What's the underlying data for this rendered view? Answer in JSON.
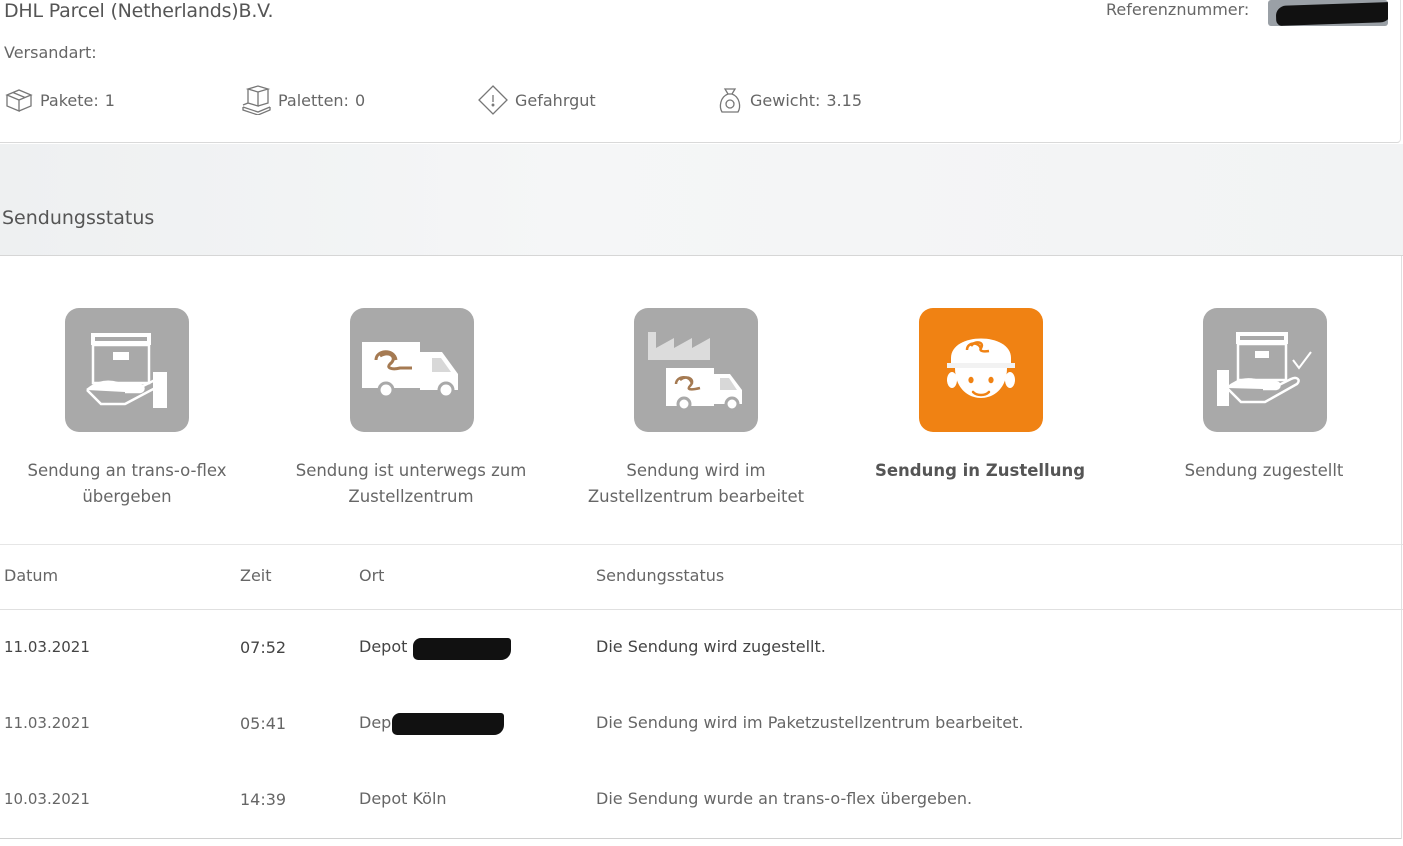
{
  "header": {
    "company": "DHL Parcel (Netherlands)B.V.",
    "reference_label": "Referenznummer:",
    "shipping_type_label": "Versandart:"
  },
  "properties": [
    {
      "label": "Pakete:",
      "value": "1",
      "icon": "package-icon"
    },
    {
      "label": "Paletten:",
      "value": "0",
      "icon": "pallet-icon"
    },
    {
      "label": "Gefahrgut",
      "value": "",
      "icon": "hazard-icon"
    },
    {
      "label": "Gewicht:",
      "value": "3.15",
      "icon": "weight-icon"
    }
  ],
  "section": {
    "title": "Sendungsstatus"
  },
  "steps": [
    {
      "label": "Sendung an trans-o-flex übergeben",
      "icon": "box-handover-icon",
      "active": false
    },
    {
      "label": "Sendung ist unterwegs zum Zustellzentrum",
      "icon": "truck-icon",
      "active": false
    },
    {
      "label": "Sendung wird im Zustellzentrum bearbeitet",
      "icon": "depot-factory-icon",
      "active": false
    },
    {
      "label": "Sendung in Zustellung",
      "icon": "courier-face-icon",
      "active": true
    },
    {
      "label": "Sendung zugestellt",
      "icon": "box-delivered-icon",
      "active": false
    }
  ],
  "colors": {
    "active": "#f08213",
    "inactive": "#a9a9a9"
  },
  "table": {
    "headers": [
      "Datum",
      "Zeit",
      "Ort",
      "Sendungsstatus"
    ],
    "rows": [
      {
        "date": "11.03.2021",
        "time": "07:52",
        "location": "Depot",
        "status": "Die Sendung wird zugestellt.",
        "redacted": true
      },
      {
        "date": "11.03.2021",
        "time": "05:41",
        "location": "Depot",
        "status": "Die Sendung wird im Paketzustellzentrum bearbeitet.",
        "redacted": true
      },
      {
        "date": "10.03.2021",
        "time": "14:39",
        "location": "Depot Köln",
        "status": "Die Sendung wurde an trans-o-flex übergeben.",
        "redacted": false
      }
    ]
  }
}
